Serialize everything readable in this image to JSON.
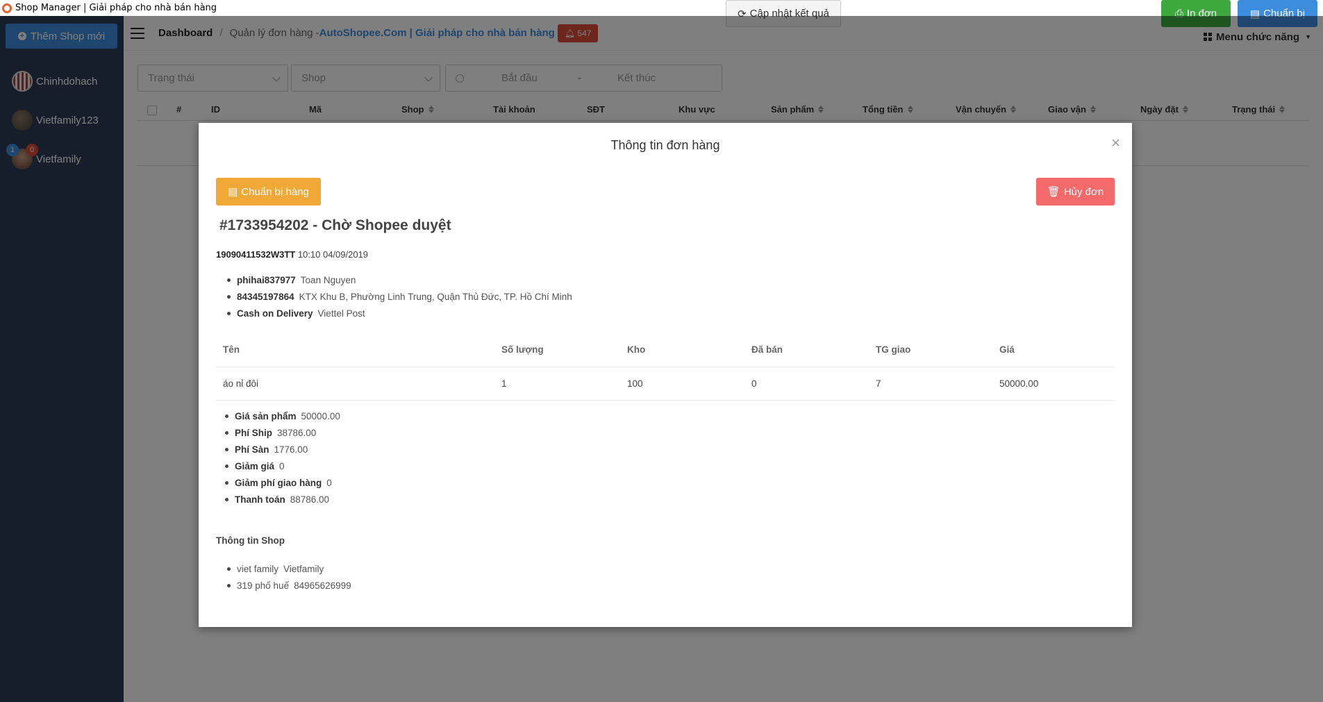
{
  "window": {
    "title": "Shop Manager | Giải pháp cho nhà bán hàng"
  },
  "sidebar": {
    "add_shop_label": "Thêm Shop mới",
    "shops": [
      {
        "name": "Chinhdohach"
      },
      {
        "name": "Vietfamily123"
      },
      {
        "name": "Vietfamily",
        "badge_blue": "1",
        "badge_red": "0"
      }
    ]
  },
  "header": {
    "breadcrumb_home": "Dashboard",
    "breadcrumb_current": "Quản lý đơn hàng - ",
    "breadcrumb_brand": "AutoShopee.Com | Giải pháp cho nhà bán hàng",
    "notification_count": "547",
    "menu_label": "Menu chức năng"
  },
  "filters": {
    "status_placeholder": "Trạng thái",
    "shop_placeholder": "Shop",
    "start_placeholder": "Bắt đầu",
    "date_separator": "-",
    "end_placeholder": "Kết thúc",
    "update_label": "Cập nhật kết quả",
    "print_label": "In đơn",
    "prepare_label": "Chuẩn bị"
  },
  "table": {
    "columns": [
      "#",
      "ID",
      "Mã",
      "Shop",
      "Tài khoản",
      "SĐT",
      "Khu vực",
      "Sản phẩm",
      "Tổng tiền",
      "Vận chuyển",
      "Giao vận",
      "Ngày đặt",
      "Trạng thái"
    ]
  },
  "modal": {
    "title": "Thông tin đơn hàng",
    "prepare_goods_label": "Chuẩn bị hàng",
    "cancel_label": "Hủy đơn",
    "order_heading": "#1733954202 - Chờ Shopee duyệt",
    "order_code": "19090411532W3TT",
    "order_time": " 10:10 04/09/2019",
    "customer": [
      {
        "key": "phihai837977",
        "value": "Toan Nguyen"
      },
      {
        "key": "84345197864",
        "value": "KTX Khu B, Phường Linh Trung, Quận Thủ Đức, TP. Hồ Chí Minh"
      },
      {
        "key": "Cash on Delivery",
        "value": "Viettel Post"
      }
    ],
    "products_header": [
      "Tên",
      "Số lượng",
      "Kho",
      "Đã bán",
      "TG giao",
      "Giá"
    ],
    "products": [
      [
        "áo nỉ đôi",
        "1",
        "100",
        "0",
        "7",
        "50000.00"
      ]
    ],
    "totals": [
      {
        "key": "Giá sản phẩm",
        "value": "50000.00"
      },
      {
        "key": "Phí Ship",
        "value": "38786.00"
      },
      {
        "key": "Phí Sàn",
        "value": "1776.00"
      },
      {
        "key": "Giảm giá",
        "value": "0"
      },
      {
        "key": "Giảm phí giao hàng",
        "value": "0"
      },
      {
        "key": "Thanh toán",
        "value": "88786.00"
      }
    ],
    "shop_info_heading": "Thông tin Shop",
    "shop_info": [
      {
        "key": "viet family",
        "value": "Vietfamily"
      },
      {
        "key": "319 phố huế",
        "value": "84965626999"
      }
    ]
  }
}
